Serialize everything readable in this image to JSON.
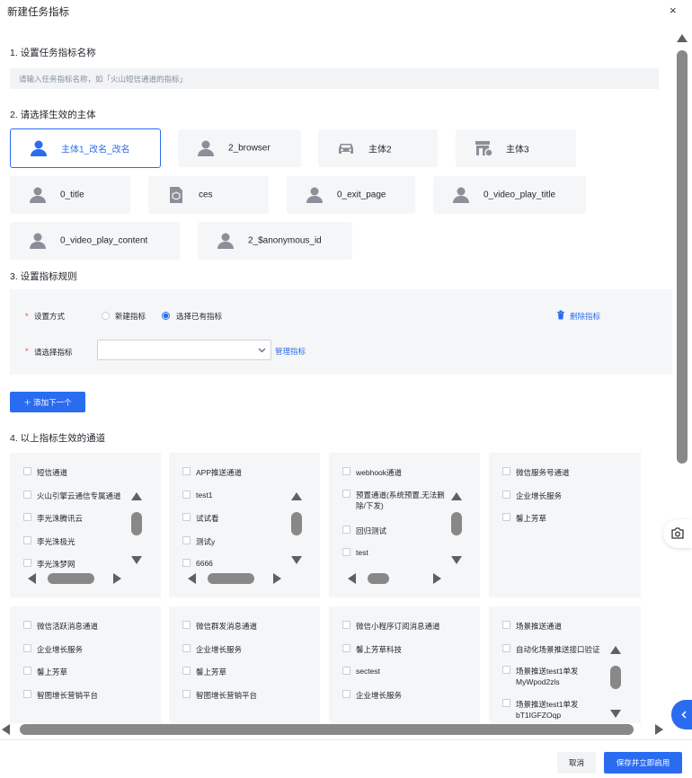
{
  "dialog": {
    "title": "新建任务指标",
    "close_symbol": "×"
  },
  "step1": {
    "label": "1. 设置任务指标名称",
    "placeholder": "请输入任务指标名称，如「火山短信通道的指标」"
  },
  "step2": {
    "label": "2. 请选择生效的主体",
    "entities": [
      {
        "label": "主体1_改名_改名",
        "icon": "user-icon",
        "selected": true
      },
      {
        "label": "2_browser",
        "icon": "user-icon"
      },
      {
        "label": "主体2",
        "icon": "car-icon"
      },
      {
        "label": "主体3",
        "icon": "store-icon"
      },
      {
        "label": "0_title",
        "icon": "user-icon"
      },
      {
        "label": "ces",
        "icon": "cube-doc-icon"
      },
      {
        "label": "0_exit_page",
        "icon": "user-icon"
      },
      {
        "label": "0_video_play_title",
        "icon": "user-icon"
      },
      {
        "label": "0_video_play_content",
        "icon": "user-icon"
      },
      {
        "label": "2_$anonymous_id",
        "icon": "user-icon"
      }
    ]
  },
  "step3": {
    "label": "3. 设置指标规则",
    "mode_label": "设置方式",
    "required_mark": "*",
    "option_new": "新建指标",
    "option_existing": "选择已有指标",
    "selected_option": "选择已有指标",
    "delete_label": "删除指标",
    "indicator_label": "请选择指标",
    "indicator_value": "",
    "manage_label": "管理指标",
    "add_label": "＋ 添加下一个"
  },
  "step4": {
    "label": "4. 以上指标生效的通道",
    "groups": [
      {
        "items": [
          "短信通道",
          "火山引擎云通信专属通道",
          "李光洙腾讯云",
          "李光洙极光",
          "李光洙梦网"
        ]
      },
      {
        "items": [
          "APP推送通道",
          "test1",
          "试试看",
          "测试y",
          "6666"
        ]
      },
      {
        "items": [
          "webhook通道",
          "预置通道(系统预置,无法删除/下发)",
          "回归测试",
          "test"
        ]
      },
      {
        "items": [
          "微信服务号通道",
          "企业增长服务",
          "馨上芳草"
        ]
      },
      {
        "items": [
          "微信活跃消息通道",
          "企业增长服务",
          "馨上芳草",
          "智图增长营销平台"
        ]
      },
      {
        "items": [
          "微信群发消息通道",
          "企业增长服务",
          "馨上芳草",
          "智图增长营销平台"
        ]
      },
      {
        "items": [
          "微信小程序订阅消息通道",
          "馨上芳草科技",
          "sectest",
          "企业增长服务"
        ]
      },
      {
        "items": [
          "场景推送通道",
          "自动化场景推送接口验证",
          "场景推送test1单发MyWpod2zls",
          "场景推送test1单发bT1IGFZOqp"
        ]
      }
    ]
  },
  "footer": {
    "cancel_label": "取消",
    "save_label": "保存并立即启用"
  },
  "icons": {
    "close": "close-icon",
    "trash": "trash-icon",
    "chevron": "chevron-down-icon",
    "camera": "camera-icon",
    "collapse": "chevron-left-icon"
  },
  "colors": {
    "accent": "#2a6cf0",
    "panel": "#f5f6f7",
    "required": "#f53f3f"
  }
}
